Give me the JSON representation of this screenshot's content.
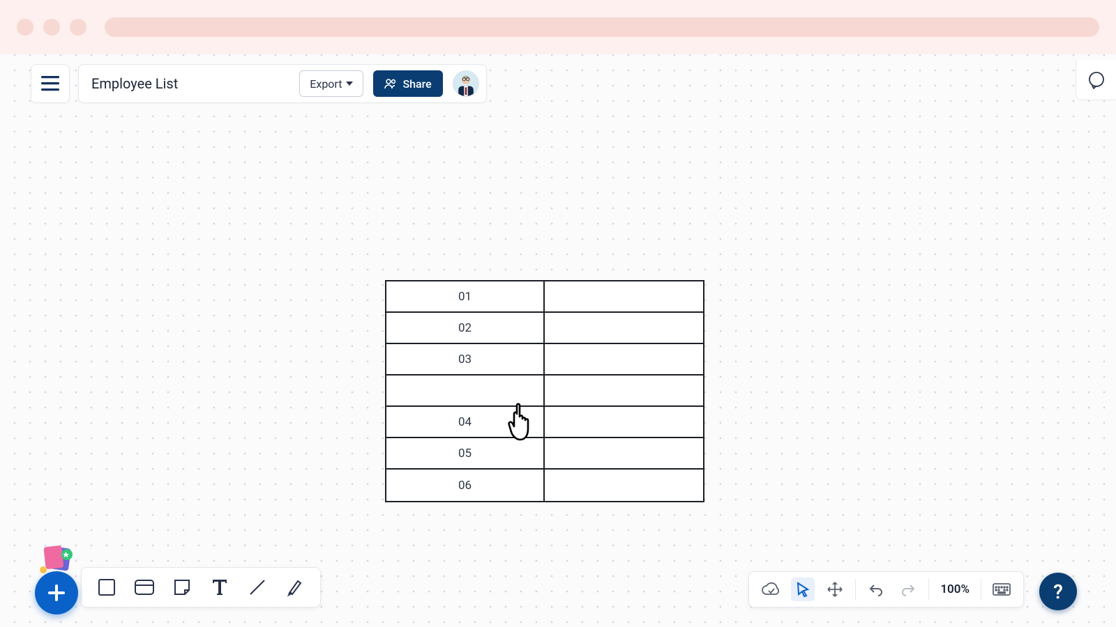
{
  "header": {
    "title": "Employee List",
    "export_label": "Export",
    "share_label": "Share"
  },
  "table": {
    "rows": [
      {
        "a": "01",
        "b": ""
      },
      {
        "a": "02",
        "b": ""
      },
      {
        "a": "03",
        "b": ""
      },
      {
        "a": "",
        "b": ""
      },
      {
        "a": "04",
        "b": ""
      },
      {
        "a": "05",
        "b": ""
      },
      {
        "a": "06",
        "b": ""
      }
    ]
  },
  "view": {
    "zoom": "100%"
  },
  "help": {
    "label": "?"
  }
}
